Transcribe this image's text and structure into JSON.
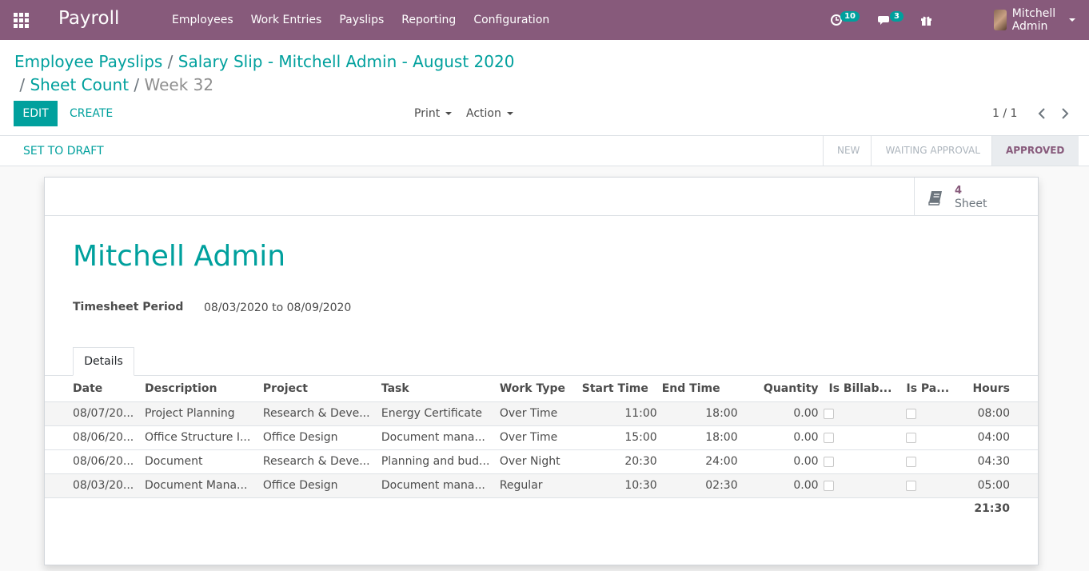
{
  "nav": {
    "brand": "Payroll",
    "menu": [
      "Employees",
      "Work Entries",
      "Payslips",
      "Reporting",
      "Configuration"
    ],
    "activity_count": "10",
    "message_count": "3",
    "user_name": "Mitchell Admin"
  },
  "breadcrumb": {
    "item1": "Employee Payslips",
    "item2": "Salary Slip - Mitchell Admin - August 2020",
    "item3": "Sheet Count",
    "current": "Week 32",
    "separator": "/"
  },
  "toolbar": {
    "edit_label": "EDIT",
    "create_label": "CREATE",
    "print_label": "Print",
    "action_label": "Action",
    "pager": "1 / 1"
  },
  "statusbar": {
    "draft_label": "SET TO DRAFT",
    "stages": [
      "NEW",
      "WAITING APPROVAL",
      "APPROVED"
    ],
    "current_stage": "APPROVED"
  },
  "stat_button": {
    "value": "4",
    "label": "Sheet",
    "icon": "book-icon"
  },
  "form": {
    "employee_name": "Mitchell Admin",
    "period_label": "Timesheet Period",
    "period_value": "08/03/2020 to 08/09/2020",
    "tab_label": "Details"
  },
  "table": {
    "headers": [
      "Date",
      "Description",
      "Project",
      "Task",
      "Work Type",
      "Start Time",
      "End Time",
      "Quantity",
      "Is Billab...",
      "Is Pa...",
      "Hours"
    ],
    "rows": [
      {
        "date": "08/07/20...",
        "description": "Project Planning",
        "project": "Research & Deve...",
        "task": "Energy Certificate",
        "work_type": "Over Time",
        "start": "11:00",
        "end": "18:00",
        "quantity": "0.00",
        "hours": "08:00"
      },
      {
        "date": "08/06/20...",
        "description": "Office Structure I...",
        "project": "Office Design",
        "task": "Document mana...",
        "work_type": "Over Time",
        "start": "15:00",
        "end": "18:00",
        "quantity": "0.00",
        "hours": "04:00"
      },
      {
        "date": "08/06/20...",
        "description": "Document",
        "project": "Research & Deve...",
        "task": "Planning and bud...",
        "work_type": "Over Night",
        "start": "20:30",
        "end": "24:00",
        "quantity": "0.00",
        "hours": "04:30"
      },
      {
        "date": "08/03/20...",
        "description": "Document Mana...",
        "project": "Office Design",
        "task": "Document mana...",
        "work_type": "Regular",
        "start": "10:30",
        "end": "02:30",
        "quantity": "0.00",
        "hours": "05:00"
      }
    ],
    "total_hours": "21:30"
  },
  "colors": {
    "brand": "#875a7b",
    "accent": "#00a09d"
  }
}
